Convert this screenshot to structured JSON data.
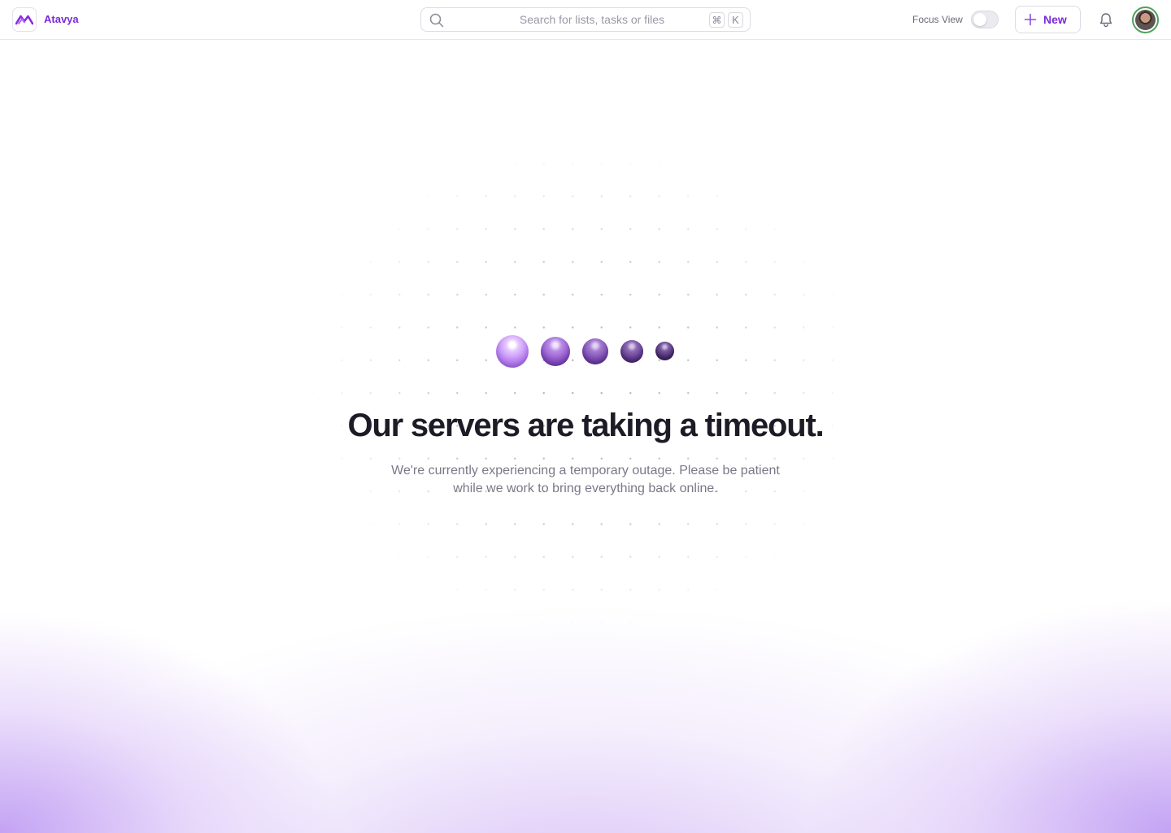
{
  "app": {
    "name": "Atavya",
    "accent": "#7a2ad8"
  },
  "header": {
    "search": {
      "placeholder": "Search for lists, tasks or files",
      "shortcut_keys": [
        "⌘",
        "K"
      ]
    },
    "focus_view": {
      "label": "Focus View",
      "enabled": false
    },
    "new_button": {
      "label": "New",
      "icon": "plus-icon"
    },
    "notifications_icon": "bell-icon",
    "avatar": "user-avatar"
  },
  "main": {
    "loading_indicator": {
      "orb_count": 5,
      "colors": [
        "#b77cf2",
        "#8f55c9",
        "#7a48b0",
        "#5f3a8a",
        "#4a2d6d"
      ]
    },
    "title": "Our servers are taking a timeout.",
    "message": "We're currently experiencing a temporary outage. Please be patient while we work to bring everything back online."
  }
}
